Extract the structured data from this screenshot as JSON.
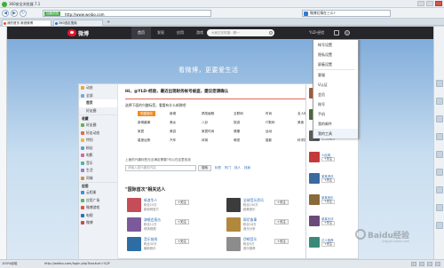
{
  "browser": {
    "title": "360安全浏览器 7.1",
    "secure_label": "加速浏览",
    "url": "http://www.weibo.com",
    "search_text": "微博后情在三么?",
    "tabs": [
      {
        "label": "我的首页 新浪微博"
      },
      {
        "label": "360选定搜索"
      }
    ],
    "new_tab_symbol": "+",
    "back_symbol": "◀",
    "forward_symbol": "▶",
    "refresh_symbol": "↻"
  },
  "weibo": {
    "logo_text": "微博",
    "nav": [
      "首页",
      "发现",
      "应用",
      "游戏"
    ],
    "search_placeholder": "大家正在热搜：哪一",
    "user_name": "YLD-经验",
    "slogan": "看微博，更要爱生活",
    "dropdown": [
      "帐号设置",
      "隐私设置",
      "屏蔽设置",
      "客服",
      "V认证",
      "会员",
      "账号",
      "手机",
      "我的邮件",
      "我的工具",
      "退出"
    ],
    "left_menu": {
      "top": [
        "动态",
        "全部"
      ],
      "first_section": "首页",
      "first_items": [
        "好友圈",
        "特别关注"
      ],
      "section_b": "收藏",
      "items": [
        "好友圈",
        "好友动态",
        "特别",
        "粉丝",
        "电影",
        "音乐",
        "生活",
        "同城"
      ],
      "section_c": "应用",
      "apps": [
        "云相册",
        "应用广场",
        "微博游戏",
        "电视",
        "微博"
      ]
    },
    "notice": "Hi，@YLD-经验，最近出现财务帐号被盗，建议您请确认",
    "prompt": "选择下面的兴趣标签，看看有什么新鲜吧",
    "tags": [
      "明星娱乐",
      "新闻",
      "搞笑幽默",
      "互联网",
      "时尚",
      "名人明星",
      "新闻趣事",
      "美女",
      "八卦",
      "旅游",
      "IT数码",
      "美食",
      "家居",
      "美容",
      "家居时尚",
      "健康",
      "运动",
      "星座运势",
      "汽车",
      "体育",
      "萌宠",
      "摄影",
      "科学探索"
    ],
    "ask_text": "上面的兴趣标签无法满足需要?可以在这里找找",
    "ask_placeholder": "请输入感兴趣的内容",
    "ask_button": "搜索",
    "ask_links": [
      "标签",
      "热门",
      "找人",
      "找我"
    ],
    "people_title": "\"国际首次\"相关达人",
    "people": [
      {
        "name": "新浪华人",
        "fans": "粉丝25万",
        "desc": "新浪网官方",
        "follow": "+关注"
      },
      {
        "name": "全球音乐资讯",
        "fans": "粉丝150万",
        "desc": "欧美音乐",
        "follow": "+关注"
      },
      {
        "name": "演唱会直击",
        "fans": "粉丝12万",
        "desc": "现场视频",
        "follow": "+关注"
      },
      {
        "name": "耶尼鲁事",
        "fans": "粉丝18万",
        "desc": "音乐分享",
        "follow": "+关注"
      },
      {
        "name": "音乐前线",
        "fans": "粉丝30万",
        "desc": "最新音乐",
        "follow": "+关注"
      },
      {
        "name": "伊顿音乐",
        "fans": "粉丝9万",
        "desc": "音乐推荐",
        "follow": "+关注"
      }
    ],
    "right_items": [
      {
        "name": "王力宏",
        "btn": "+关注"
      },
      {
        "name": "王二",
        "btn": "+关注"
      },
      {
        "name": "日本资讯",
        "btn": "+关注"
      },
      {
        "name": "人民网",
        "btn": "+关注"
      },
      {
        "name": "某某资讯",
        "btn": "+关注"
      },
      {
        "name": "某某音乐",
        "btn": "+关注"
      },
      {
        "name": "某某乐评",
        "btn": "+关注"
      },
      {
        "name": "达人推荐",
        "btn": "+关注"
      }
    ]
  },
  "status": {
    "left": "100%经验",
    "url": "http://weibo.com/login.php?backurl=%2F",
    "watermark": "Baidu经验",
    "watermark_sub": "jingyan.baidu.com"
  }
}
